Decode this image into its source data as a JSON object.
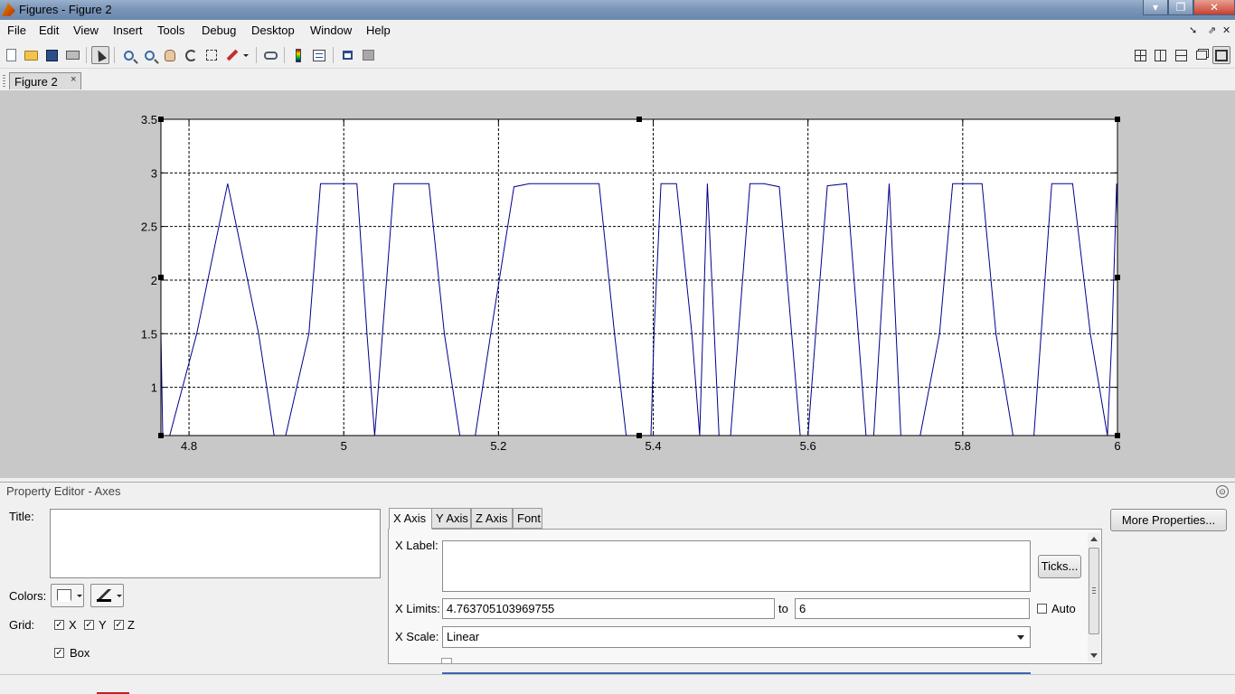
{
  "window": {
    "title": "Figures - Figure 2"
  },
  "menu": {
    "items": [
      "File",
      "Edit",
      "View",
      "Insert",
      "Tools",
      "Debug",
      "Desktop",
      "Window",
      "Help"
    ]
  },
  "toolbar": {
    "icons": [
      "new-figure-icon",
      "open-file-icon",
      "save-figure-icon",
      "print-figure-icon",
      "edit-plot-icon",
      "zoom-in-icon",
      "zoom-out-icon",
      "pan-icon",
      "rotate-3d-icon",
      "data-cursor-icon",
      "brush-icon",
      "link-plot-icon",
      "insert-colorbar-icon",
      "insert-legend-icon",
      "hide-plot-tools-icon",
      "show-plot-tools-icon"
    ],
    "layout_icons": [
      "tile-icon",
      "left-right-icon",
      "top-bottom-icon",
      "float-icon",
      "maximize-icon"
    ]
  },
  "figure_tab": {
    "label": "Figure 2",
    "close": "×"
  },
  "chart_data": {
    "type": "line",
    "xlim": [
      4.763705103969755,
      6
    ],
    "ylim": [
      0.55,
      3.5
    ],
    "xticks": [
      "4.8",
      "5",
      "5.2",
      "5.4",
      "5.6",
      "5.8",
      "6"
    ],
    "yticks": [
      "3.5",
      "3",
      "2.5",
      "2",
      "1.5",
      "1"
    ],
    "grid": true,
    "color": "#00008b",
    "x": [
      4.7637,
      4.766,
      4.775,
      4.81,
      4.85,
      4.89,
      4.91,
      4.925,
      4.955,
      4.97,
      5.0,
      5.017,
      5.03,
      5.04,
      5.065,
      5.08,
      5.11,
      5.13,
      5.15,
      5.17,
      5.19,
      5.22,
      5.24,
      5.33,
      5.35,
      5.365,
      5.397,
      5.401,
      5.41,
      5.43,
      5.45,
      5.46,
      5.47,
      5.485,
      5.5,
      5.525,
      5.543,
      5.563,
      5.59,
      5.6,
      5.61,
      5.625,
      5.65,
      5.665,
      5.675,
      5.685,
      5.705,
      5.72,
      5.745,
      5.77,
      5.787,
      5.825,
      5.843,
      5.865,
      5.892,
      5.915,
      5.942,
      5.965,
      5.987,
      5.993,
      5.999,
      6.0
    ],
    "y": [
      1.5,
      0.55,
      0.55,
      1.5,
      2.9,
      1.5,
      0.55,
      0.55,
      1.5,
      2.9,
      2.9,
      2.9,
      1.5,
      0.55,
      2.9,
      2.9,
      2.9,
      1.5,
      0.55,
      0.55,
      1.5,
      2.87,
      2.9,
      2.9,
      1.5,
      0.55,
      0.55,
      1.5,
      2.9,
      2.9,
      1.5,
      0.55,
      2.9,
      0.55,
      0.55,
      2.9,
      2.9,
      2.87,
      0.55,
      0.55,
      1.5,
      2.88,
      2.9,
      1.5,
      0.55,
      0.55,
      2.9,
      0.55,
      0.55,
      1.5,
      2.9,
      2.9,
      1.5,
      0.55,
      0.55,
      2.9,
      2.9,
      1.5,
      0.55,
      1.5,
      2.9,
      2.6
    ]
  },
  "property_editor": {
    "header": "Property Editor - Axes",
    "collapse_glyph": "⊙",
    "title_label": "Title:",
    "title_value": "",
    "colors_label": "Colors:",
    "grid_label": "Grid:",
    "grid_x_label": "X",
    "grid_y_label": "Y",
    "grid_z_label": "Z",
    "box_label": "Box",
    "check": "✓",
    "tabs": [
      "X Axis",
      "Y Axis",
      "Z Axis",
      "Font"
    ],
    "x_label_label": "X Label:",
    "x_label_value": "",
    "ticks_button": "Ticks...",
    "x_limits_label": "X Limits:",
    "x_limit_min": "4.763705103969755",
    "to_label": "to",
    "x_limit_max": "6",
    "auto_label": "Auto",
    "x_scale_label": "X Scale:",
    "x_scale_value": "Linear",
    "more_properties_button": "More Properties..."
  }
}
